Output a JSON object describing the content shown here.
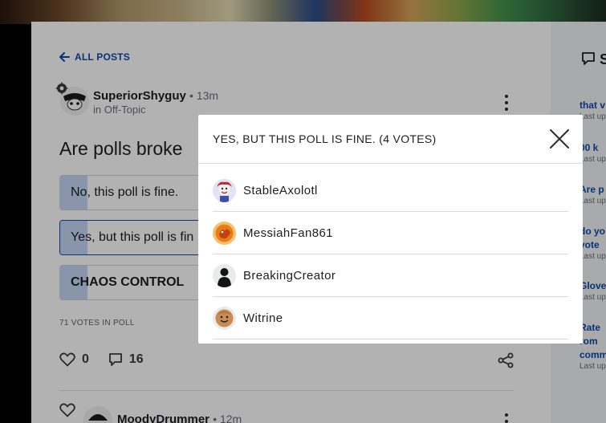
{
  "nav": {
    "back_label": "ALL POSTS"
  },
  "post": {
    "author": "SuperiorShyguy",
    "time": "13m",
    "location": "in Off-Topic",
    "title": "Are polls broke",
    "options": [
      {
        "label": "No, this poll is fine.",
        "percent": 6,
        "selected": false
      },
      {
        "label": "Yes, but this poll is fin",
        "percent": 6,
        "selected": true
      },
      {
        "label": "CHAOS CONTROL",
        "percent": 6,
        "selected": false
      }
    ],
    "votes_in_poll": "71 VOTES IN POLL",
    "likes": "0",
    "comments": "16"
  },
  "next_post": {
    "author": "MoodyDrummer",
    "time": "12m"
  },
  "rail": {
    "heading": "S",
    "items": [
      {
        "title": [
          "that v"
        ],
        "sub": "Last up"
      },
      {
        "title": [
          "00 k"
        ],
        "sub": "Last up"
      },
      {
        "title": [
          "Are p"
        ],
        "sub": "Last up"
      },
      {
        "title": [
          "do yo",
          "vote"
        ],
        "sub": "Last up"
      },
      {
        "title": [
          "Glove"
        ],
        "sub": "Last up"
      },
      {
        "title": [
          "Rate",
          "rom",
          "comm"
        ],
        "sub": "Last up"
      }
    ]
  },
  "modal": {
    "title": "YES, BUT THIS POLL IS FINE. (4 VOTES)",
    "voters": [
      "StableAxolotl",
      "MessiahFan861",
      "BreakingCreator",
      "Witrine"
    ]
  },
  "colors": {
    "link": "#0b4aa8",
    "poll_fill": "#c5d6f5",
    "overlay": "rgba(0,0,0,0.30)"
  }
}
